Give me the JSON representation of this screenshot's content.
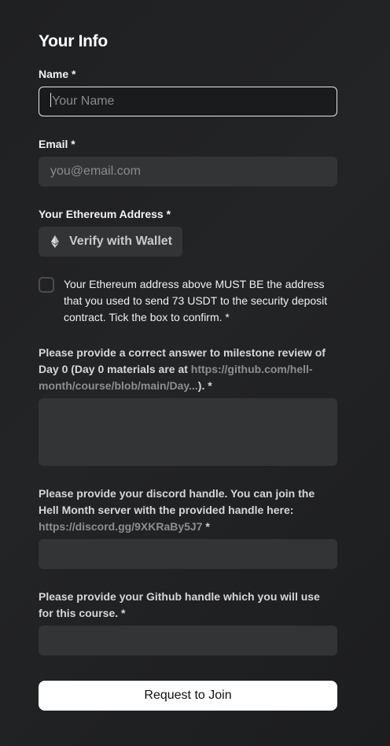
{
  "header": {
    "title": "Your Info"
  },
  "fields": {
    "name": {
      "label": "Name *",
      "placeholder": "Your Name"
    },
    "email": {
      "label": "Email *",
      "placeholder": "you@email.com"
    },
    "eth": {
      "label": "Your Ethereum Address *",
      "button": "Verify with Wallet"
    },
    "confirm": {
      "text": "Your Ethereum address above MUST BE the address that you used to send 73 USDT to the security deposit contract. Tick the box to confirm. *"
    },
    "milestone": {
      "text_before": "Please provide a correct answer to milestone review of Day 0 (Day 0 materials are at ",
      "link": "https://github.com/hell-month/course/blob/main/Day...",
      "text_after": "). *"
    },
    "discord": {
      "text_before": "Please provide your discord handle. You can join the Hell Month server with the provided handle here: ",
      "link": "https://discord.gg/9XKRaBy5J7",
      "text_after": " *"
    },
    "github": {
      "text": "Please provide your Github handle which you will use for this course. *"
    }
  },
  "submit": {
    "label": "Request to Join"
  },
  "colors": {
    "background": "#1f2022",
    "input_bg": "#333436",
    "button_bg": "#ffffff"
  }
}
